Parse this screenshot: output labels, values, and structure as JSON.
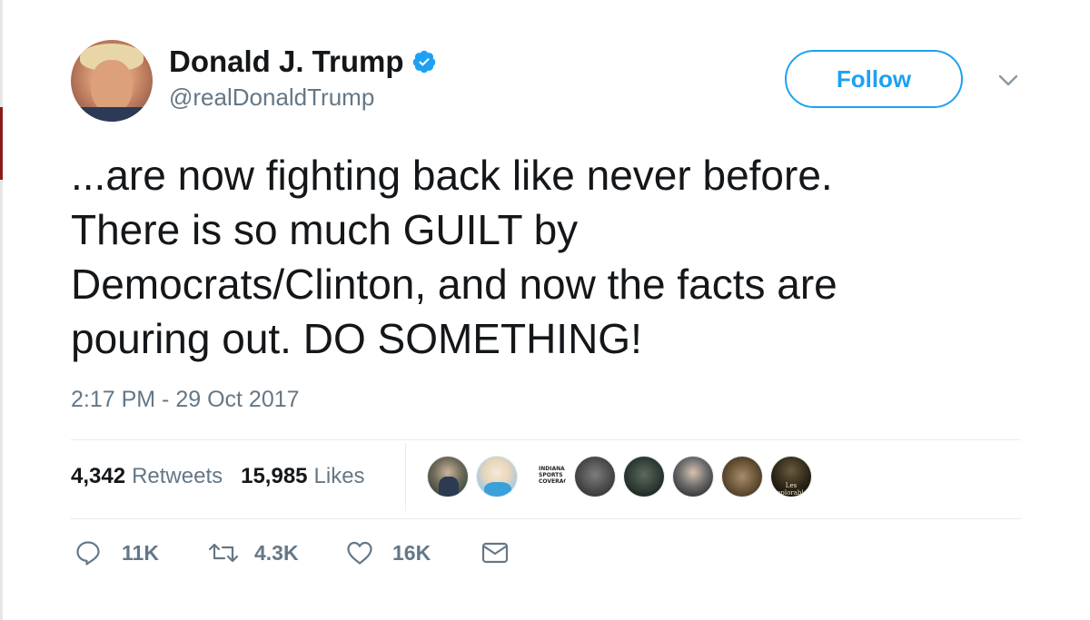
{
  "author": {
    "display_name": "Donald J. Trump",
    "handle": "@realDonaldTrump",
    "verified": true
  },
  "header": {
    "follow_label": "Follow"
  },
  "tweet": {
    "lines": [
      "...are now fighting back like never before.",
      "There is so much GUILT by",
      "Democrats/Clinton, and now the facts are",
      "pouring out. DO SOMETHING!"
    ],
    "timestamp": "2:17 PM - 29 Oct 2017"
  },
  "stats": {
    "retweets_count": "4,342",
    "retweets_label": "Retweets",
    "likes_count": "15,985",
    "likes_label": "Likes"
  },
  "likers": [
    {
      "name": "liker-avatar-1"
    },
    {
      "name": "liker-avatar-2"
    },
    {
      "name": "liker-avatar-3",
      "logo_text": "INDIANA SPORTS COVERAGE"
    },
    {
      "name": "liker-avatar-4"
    },
    {
      "name": "liker-avatar-5"
    },
    {
      "name": "liker-avatar-6"
    },
    {
      "name": "liker-avatar-7"
    },
    {
      "name": "liker-avatar-8",
      "caption": "Les Deplorables"
    }
  ],
  "actions": {
    "reply_count": "11K",
    "retweet_count": "4.3K",
    "like_count": "16K"
  },
  "colors": {
    "accent": "#1da1f2",
    "text_primary": "#14171a",
    "text_secondary": "#657786",
    "divider": "#e6ecf0"
  },
  "icons": {
    "verified": "verified-badge-icon",
    "caret": "chevron-down-icon",
    "reply": "reply-icon",
    "retweet": "retweet-icon",
    "like": "heart-icon",
    "dm": "envelope-icon"
  }
}
